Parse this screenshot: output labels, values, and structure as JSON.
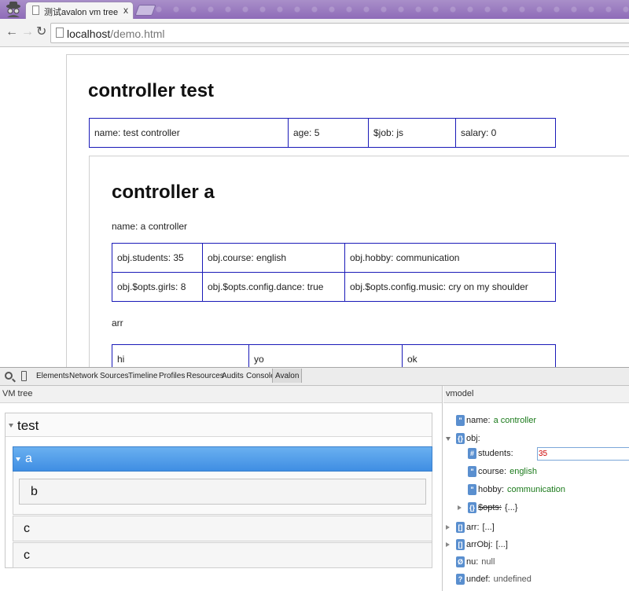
{
  "browser": {
    "tab_title": "测试avalon vm tree",
    "tab_close": "x",
    "url_host": "localhost",
    "url_path": "/demo.html"
  },
  "page": {
    "controller_test": {
      "title": "controller test",
      "cells": [
        "name: test controller",
        "age: 5",
        "$job: js",
        "salary: 0"
      ]
    },
    "controller_a": {
      "title": "controller a",
      "name_line": "name: a controller",
      "obj_rows": [
        [
          "obj.students: 35",
          "obj.course: english",
          "obj.hobby: communication"
        ],
        [
          "obj.$opts.girls: 8",
          "obj.$opts.config.dance: true",
          "obj.$opts.config.music: cry on my shoulder"
        ]
      ],
      "arr_label": "arr",
      "arr_cells": [
        "hi",
        "yo",
        "ok"
      ]
    }
  },
  "devtools": {
    "tabs": [
      "Elements",
      "Network",
      "Sources",
      "Timeline",
      "Profiles",
      "Resources",
      "Audits",
      "Console",
      "Avalon"
    ],
    "active_tab": "Avalon",
    "vm_tree": {
      "header": "VM tree",
      "root": "test",
      "selected": "a",
      "child_of_a": "b",
      "siblings": [
        "c",
        "c"
      ]
    },
    "vmodel": {
      "header": "vmodel",
      "props": {
        "name": {
          "icon": "\"",
          "key": "name:",
          "value": "a controller"
        },
        "obj": {
          "icon": "{}",
          "key": "obj:"
        },
        "students": {
          "icon": "#",
          "key": "students:",
          "value": "35"
        },
        "course": {
          "icon": "\"",
          "key": "course:",
          "value": "english"
        },
        "hobby": {
          "icon": "\"",
          "key": "hobby:",
          "value": "communication"
        },
        "opts": {
          "icon": "{}",
          "key": "$opts:",
          "value": "{...}"
        },
        "arr": {
          "icon": "[]",
          "key": "arr:",
          "value": "[...]"
        },
        "arrObj": {
          "icon": "[]",
          "key": "arrObj:",
          "value": "[...]"
        },
        "nu": {
          "icon": "Ø",
          "key": "nu:",
          "value": "null"
        },
        "undef": {
          "icon": "?",
          "key": "undef:",
          "value": "undefined"
        }
      }
    }
  }
}
